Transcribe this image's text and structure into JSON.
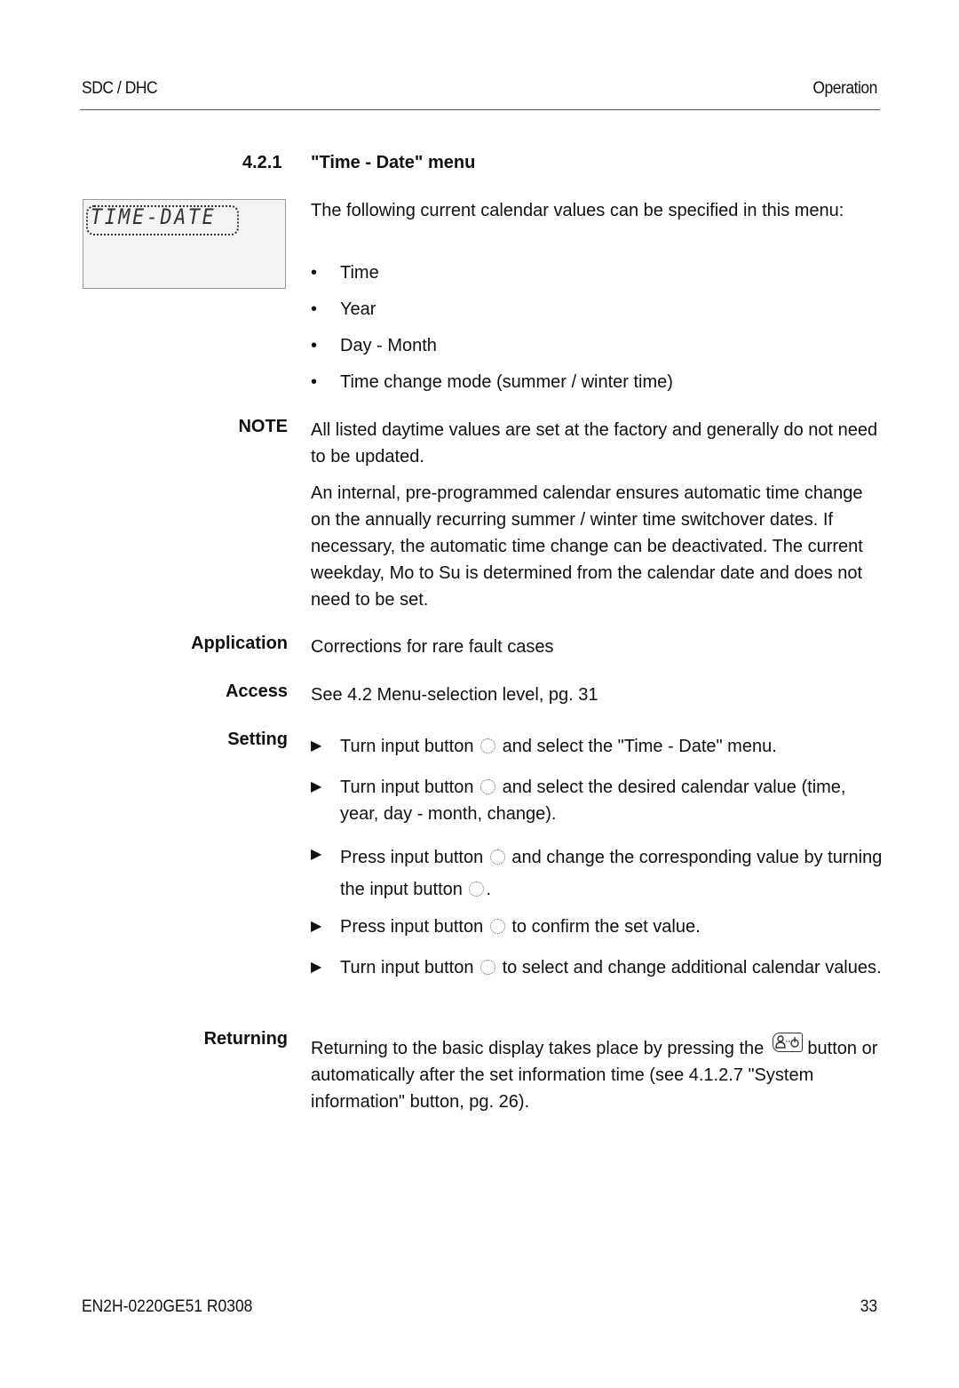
{
  "header": {
    "left": "SDC / DHC",
    "right": "Operation"
  },
  "section": {
    "number": "4.2.1",
    "title": "\"Time - Date\" menu"
  },
  "lcd_display": {
    "text": "TIME-DATE"
  },
  "intro": "The following current calendar values can be specified in this menu:",
  "bullets": [
    "Time",
    "Year",
    "Day - Month",
    "Time change mode (summer / winter time)"
  ],
  "note": {
    "label": "NOTE",
    "para1": "All listed daytime values are set at the factory and generally do not need to be updated.",
    "para2": "An internal, pre-programmed calendar ensures automatic time change on the annually recurring summer / winter time switchover dates. If necessary, the automatic time change can be deactivated. The current weekday, Mo to Su is determined from the calendar date and does not need to be set."
  },
  "application": {
    "label": "Application",
    "text": "Corrections for rare fault cases"
  },
  "access": {
    "label": "Access",
    "text": "See 4.2 Menu-selection level, pg. 31"
  },
  "setting": {
    "label": "Setting",
    "steps": [
      {
        "a": "Turn input button",
        "b": "and select the \"Time - Date\" menu."
      },
      {
        "a": "Turn input button",
        "b": "and select the desired calendar value (time, year, day - month, change)."
      },
      {
        "a": "Press input button",
        "b": "and change the corresponding value by",
        "c": "turning the input button",
        "d": "."
      },
      {
        "a": "Press input button",
        "b": "to confirm the set value."
      },
      {
        "a": "Turn input button",
        "b": "to select and change additional calendar values."
      }
    ]
  },
  "returning": {
    "label": "Returning",
    "text_a": "Returning to the basic display takes place by pressing the",
    "text_b": "button or automatically after the set information time (see 4.1.2.7 \"System information\" button, pg. 26)."
  },
  "footer": {
    "doc_id": "EN2H-0220GE51 R0308",
    "page": "33"
  }
}
